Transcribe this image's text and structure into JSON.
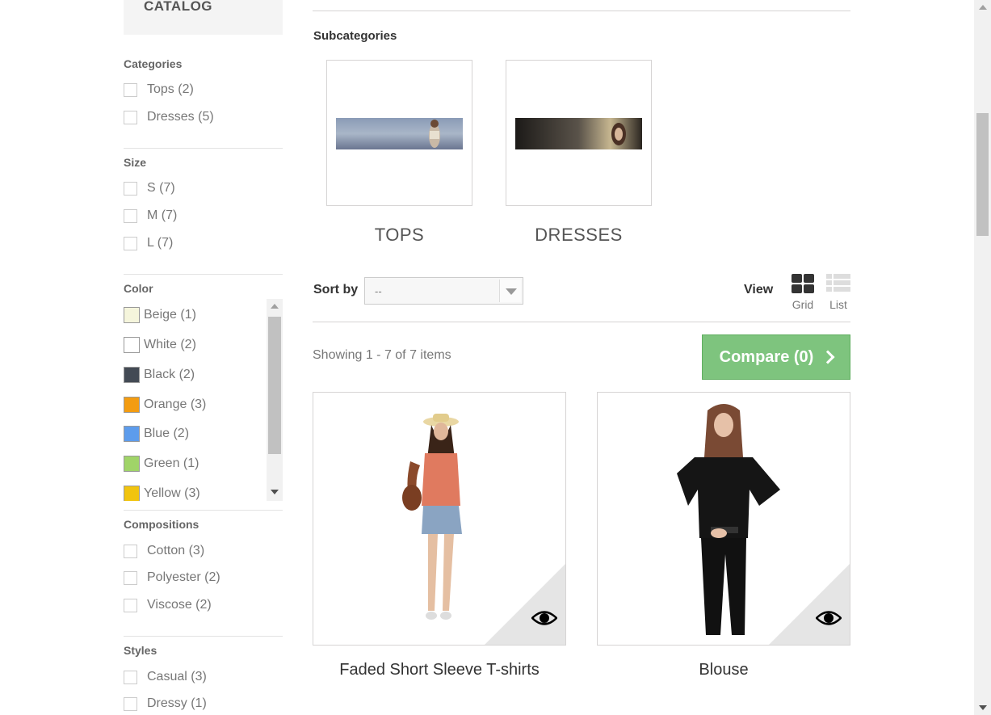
{
  "sidebar": {
    "catalog_title": "CATALOG",
    "categories": {
      "title": "Categories",
      "items": [
        "Tops (2)",
        "Dresses (5)"
      ]
    },
    "size": {
      "title": "Size",
      "items": [
        "S (7)",
        "M (7)",
        "L (7)"
      ]
    },
    "color": {
      "title": "Color",
      "items": [
        {
          "label": "Beige (1)",
          "swatch": "#f5f5dc"
        },
        {
          "label": "White (2)",
          "swatch": "#ffffff"
        },
        {
          "label": "Black (2)",
          "swatch": "#434a54"
        },
        {
          "label": "Orange (3)",
          "swatch": "#f39c11"
        },
        {
          "label": "Blue (2)",
          "swatch": "#5d9cec"
        },
        {
          "label": "Green (1)",
          "swatch": "#a0d468"
        },
        {
          "label": "Yellow (3)",
          "swatch": "#f1c40f"
        }
      ]
    },
    "compositions": {
      "title": "Compositions",
      "items": [
        "Cotton (3)",
        "Polyester (2)",
        "Viscose (2)"
      ]
    },
    "styles": {
      "title": "Styles",
      "items": [
        "Casual (3)",
        "Dressy (1)"
      ]
    }
  },
  "main": {
    "subcategories_heading": "Subcategories",
    "subcategories": [
      {
        "name": "TOPS"
      },
      {
        "name": "DRESSES"
      }
    ],
    "sort": {
      "label": "Sort by",
      "value": "--"
    },
    "view": {
      "label": "View",
      "grid": "Grid",
      "list": "List"
    },
    "showing": "Showing 1 - 7 of 7 items",
    "compare_button": "Compare (0)",
    "products": [
      {
        "name": "Faded Short Sleeve T-shirts"
      },
      {
        "name": "Blouse"
      }
    ]
  }
}
